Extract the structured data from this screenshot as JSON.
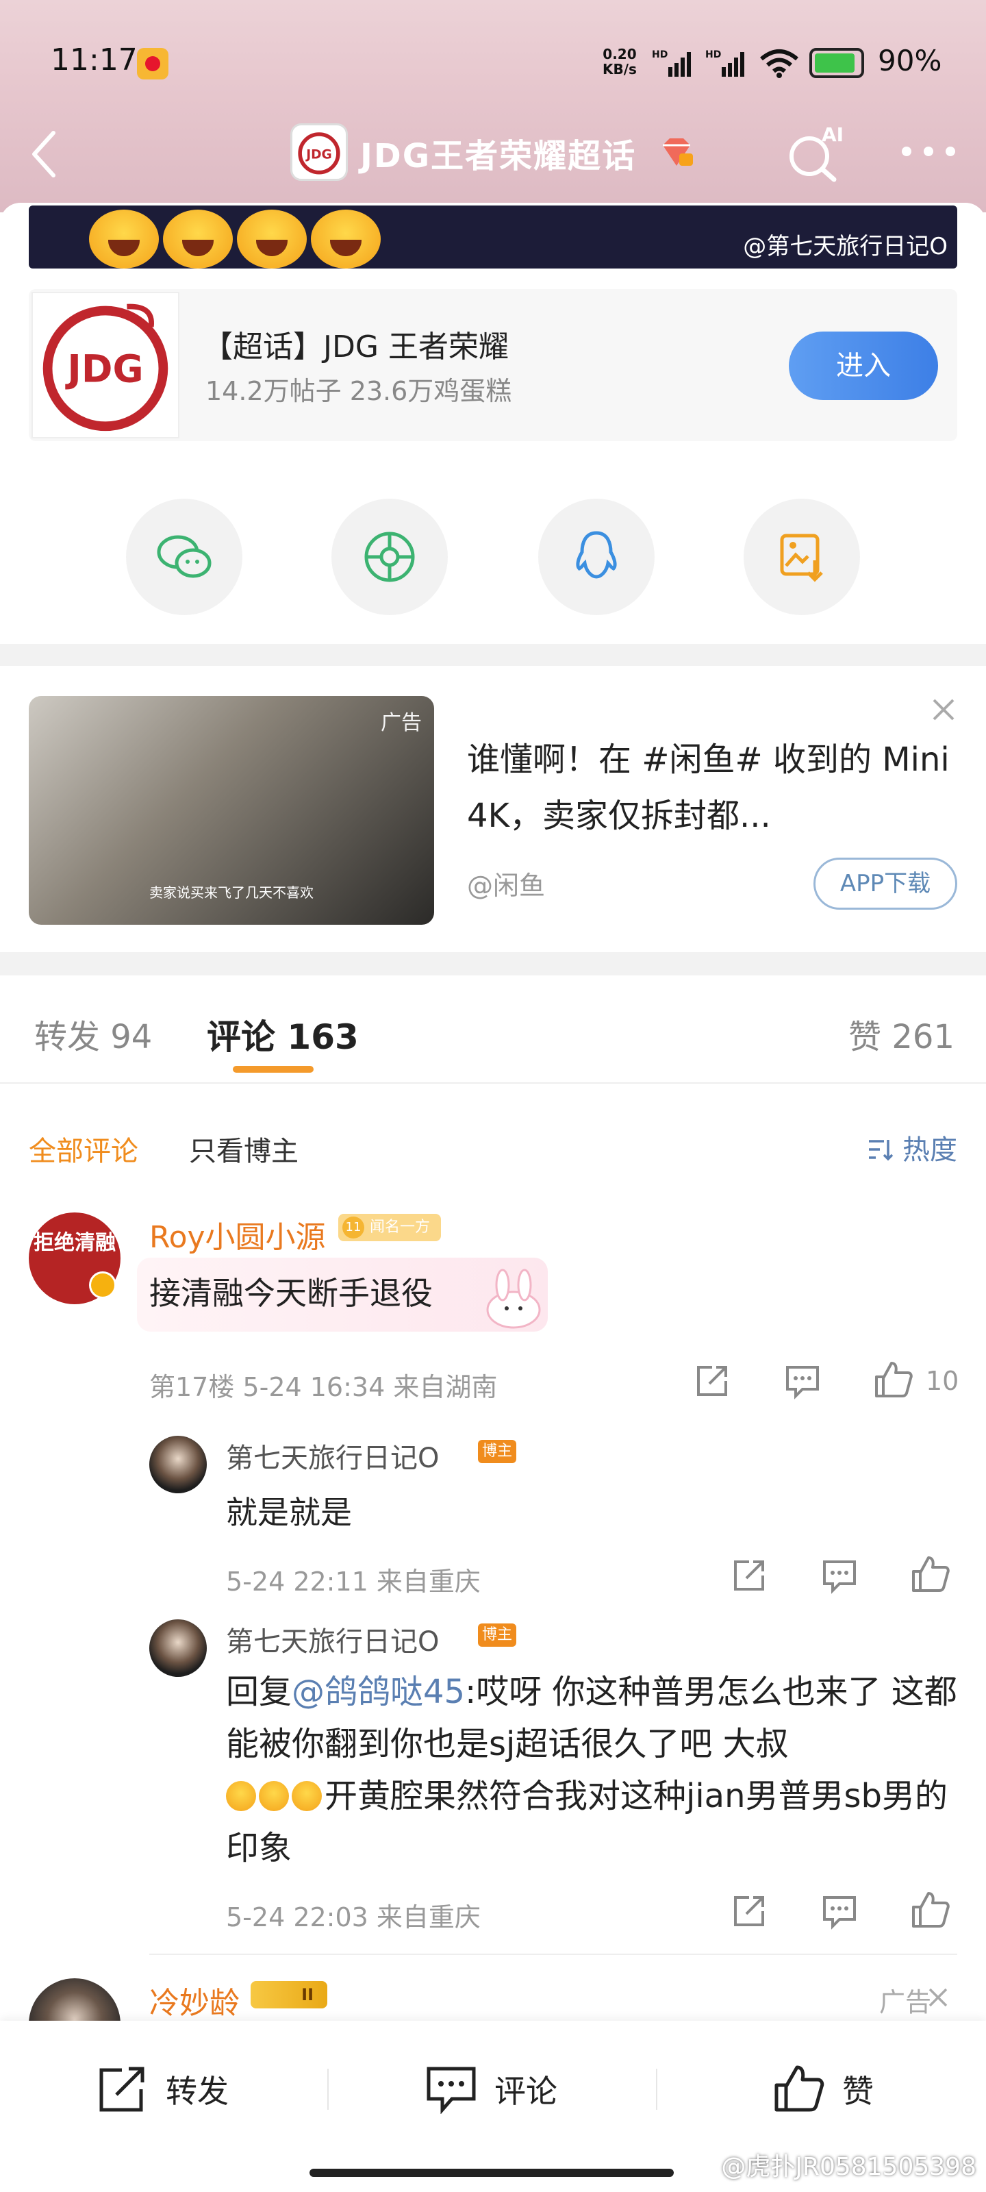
{
  "status_bar": {
    "time": "11:17",
    "net_speed_value": "0.20",
    "net_speed_unit": "KB/s",
    "battery": "90%"
  },
  "nav": {
    "title": "JDG王者荣耀超话"
  },
  "banner": {
    "credit": "@第七天旅行日记O"
  },
  "topic": {
    "name": "【超话】JDG 王者荣耀",
    "stats": "14.2万帖子 23.6万鸡蛋糕",
    "enter_label": "进入"
  },
  "ad": {
    "image_tag": "广告",
    "image_caption": "卖家说买来飞了几天不喜欢",
    "title": "谁懂啊！在 #闲鱼# 收到的 Mini 4K，卖家仅拆封都...",
    "source": "@闲鱼",
    "download_label": "APP下载"
  },
  "tabs": {
    "repost": "转发 94",
    "comment": "评论 163",
    "like": "赞 261"
  },
  "filters": {
    "all": "全部评论",
    "author_only": "只看博主",
    "sort": "热度"
  },
  "comment1": {
    "avatar_text": "拒绝清融",
    "username": "Roy小圆小源",
    "badge": "闻名一方",
    "badge_level": "11",
    "text": "接清融今天断手退役",
    "meta": "第17楼  5-24 16:34  来自湖南",
    "like_count": "10"
  },
  "reply1": {
    "username": "第七天旅行日记O",
    "tag": "博主",
    "text": "就是就是",
    "meta": "5-24 22:11  来自重庆"
  },
  "reply2": {
    "username": "第七天旅行日记O",
    "tag": "博主",
    "prefix": "回复",
    "mention": "@鸽鸽哒45",
    "text": ":哎呀 你这种普男怎么也来了 这都能被你翻到你也是sj超话很久了吧 大叔",
    "text2": "开黄腔果然符合我对这种jian男普男sb男的印象",
    "meta": "5-24 22:03  来自重庆"
  },
  "comment2": {
    "username": "冷妙龄",
    "crown_level": "II",
    "ad_label": "广告"
  },
  "bottom_bar": {
    "repost": "转发",
    "comment": "评论",
    "like": "赞"
  },
  "watermark": "@虎扑JR0581505398"
}
